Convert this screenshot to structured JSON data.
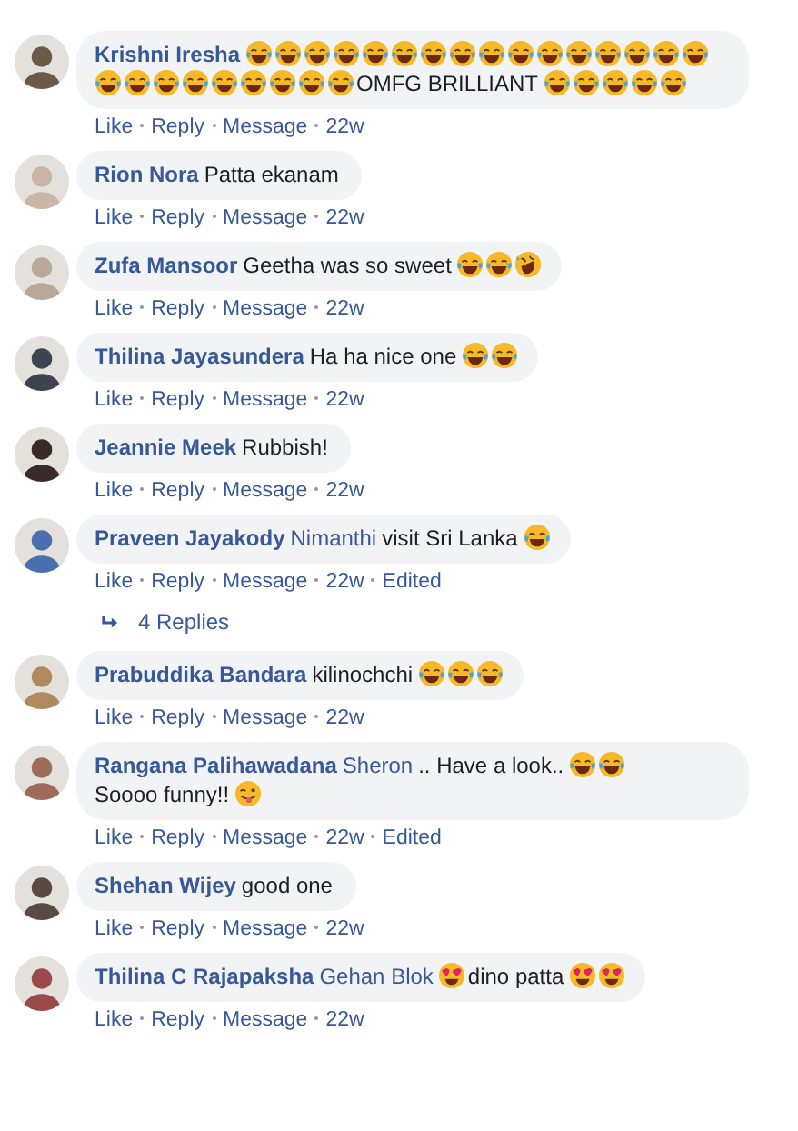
{
  "comments": [
    {
      "author": "Krishni Iresha",
      "body": [
        {
          "kind": "laugh"
        },
        {
          "kind": "laugh"
        },
        {
          "kind": "laugh"
        },
        {
          "kind": "laugh"
        },
        {
          "kind": "laugh"
        },
        {
          "kind": "laugh"
        },
        {
          "kind": "laugh"
        },
        {
          "kind": "laugh"
        },
        {
          "kind": "laugh"
        },
        {
          "kind": "laugh"
        },
        {
          "kind": "laugh"
        },
        {
          "kind": "laugh"
        },
        {
          "kind": "laugh"
        },
        {
          "kind": "laugh"
        },
        {
          "kind": "laugh"
        },
        {
          "kind": "laugh"
        },
        {
          "kind": "laugh"
        },
        {
          "kind": "laugh"
        },
        {
          "kind": "laugh"
        },
        {
          "kind": "laugh"
        },
        {
          "kind": "laugh"
        },
        {
          "kind": "laugh"
        },
        {
          "kind": "laugh"
        },
        {
          "kind": "laugh"
        },
        {
          "kind": "laugh"
        },
        {
          "kind": "text",
          "text": "OMFG BRILLIANT"
        },
        {
          "kind": "laugh"
        },
        {
          "kind": "laugh"
        },
        {
          "kind": "laugh"
        },
        {
          "kind": "laugh"
        },
        {
          "kind": "laugh"
        }
      ],
      "meta": [
        "Like",
        "Reply",
        "Message",
        "22w"
      ]
    },
    {
      "author": "Rion Nora",
      "body": [
        {
          "kind": "text",
          "text": "Patta ekanam"
        }
      ],
      "meta": [
        "Like",
        "Reply",
        "Message",
        "22w"
      ]
    },
    {
      "author": "Zufa Mansoor",
      "body": [
        {
          "kind": "text",
          "text": "Geetha was so sweet"
        },
        {
          "kind": "laugh"
        },
        {
          "kind": "laugh"
        },
        {
          "kind": "rofl"
        }
      ],
      "meta": [
        "Like",
        "Reply",
        "Message",
        "22w"
      ]
    },
    {
      "author": "Thilina Jayasundera",
      "body": [
        {
          "kind": "text",
          "text": "Ha ha nice one"
        },
        {
          "kind": "laugh"
        },
        {
          "kind": "laugh"
        }
      ],
      "meta": [
        "Like",
        "Reply",
        "Message",
        "22w"
      ]
    },
    {
      "author": "Jeannie Meek",
      "body": [
        {
          "kind": "text",
          "text": "Rubbish!"
        }
      ],
      "meta": [
        "Like",
        "Reply",
        "Message",
        "22w"
      ]
    },
    {
      "author": "Praveen Jayakody",
      "body": [
        {
          "kind": "mention",
          "text": "Nimanthi"
        },
        {
          "kind": "text",
          "text": "visit Sri Lanka"
        },
        {
          "kind": "laugh"
        }
      ],
      "meta": [
        "Like",
        "Reply",
        "Message",
        "22w",
        "Edited"
      ],
      "replies": "4 Replies"
    },
    {
      "author": "Prabuddika Bandara",
      "body": [
        {
          "kind": "text",
          "text": "kilinochchi"
        },
        {
          "kind": "laugh"
        },
        {
          "kind": "laugh"
        },
        {
          "kind": "laugh"
        }
      ],
      "meta": [
        "Like",
        "Reply",
        "Message",
        "22w"
      ]
    },
    {
      "author": "Rangana Palihawadana",
      "body": [
        {
          "kind": "mention",
          "text": "Sheron"
        },
        {
          "kind": "text",
          "text": ".. Have a look.."
        },
        {
          "kind": "laugh"
        },
        {
          "kind": "laugh"
        },
        {
          "kind": "text",
          "text": "Soooo funny!!"
        },
        {
          "kind": "wink"
        }
      ],
      "meta": [
        "Like",
        "Reply",
        "Message",
        "22w",
        "Edited"
      ]
    },
    {
      "author": "Shehan Wijey",
      "body": [
        {
          "kind": "text",
          "text": "good one"
        }
      ],
      "meta": [
        "Like",
        "Reply",
        "Message",
        "22w"
      ]
    },
    {
      "author": "Thilina C Rajapaksha",
      "body": [
        {
          "kind": "mention",
          "text": "Gehan Blok"
        },
        {
          "kind": "hearteyes"
        },
        {
          "kind": "text",
          "text": "dino patta"
        },
        {
          "kind": "hearteyes"
        },
        {
          "kind": "hearteyes"
        }
      ],
      "meta": [
        "Like",
        "Reply",
        "Message",
        "22w"
      ]
    }
  ]
}
